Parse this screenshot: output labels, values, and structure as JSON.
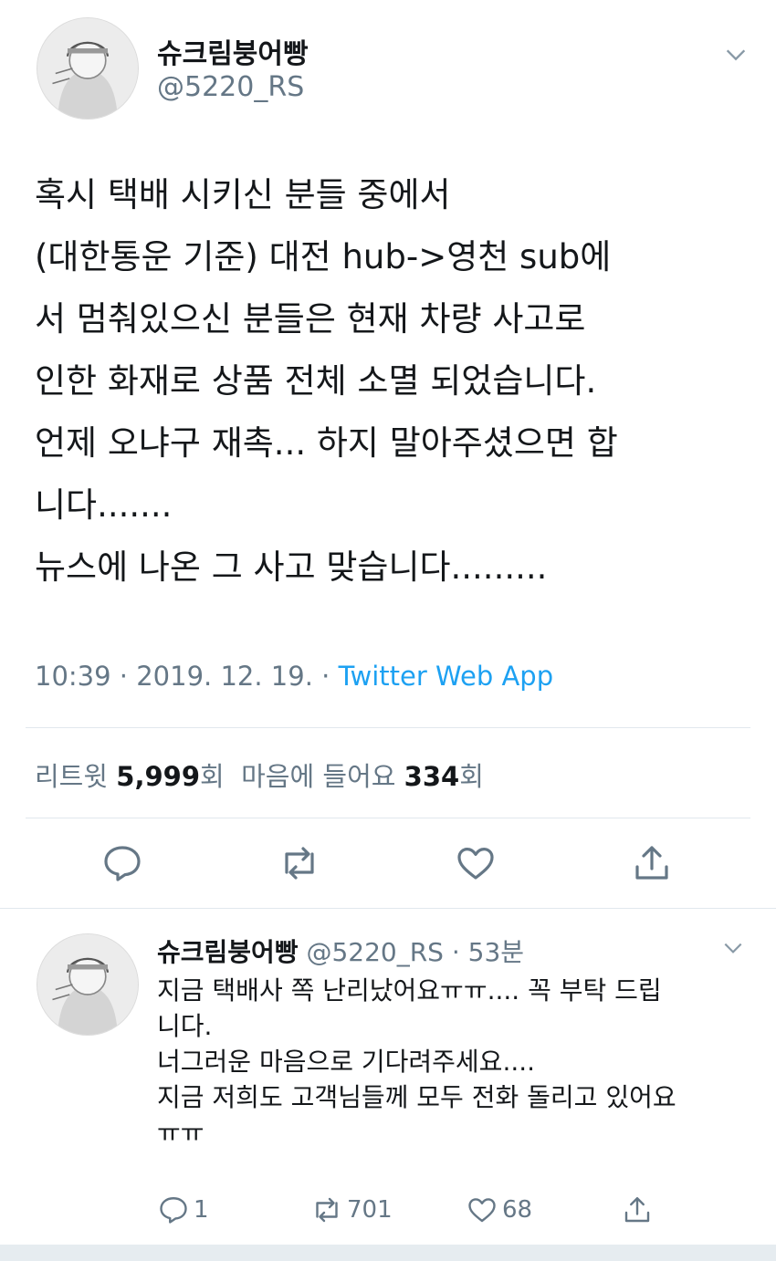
{
  "tweet": {
    "display_name": "슈크림붕어빵",
    "handle": "@5220_RS",
    "text": "혹시 택배 시키신 분들 중에서\n(대한통운 기준) 대전 hub->영천 sub에\n서 멈춰있으신 분들은 현재 차량 사고로\n인한 화재로 상품 전체 소멸 되었습니다.\n언제 오냐구 재촉... 하지 말아주셨으면 합\n니다.......\n뉴스에 나온 그 사고 맞습니다.........",
    "time": "10:39 · 2019. 12. 19. · ",
    "app": "Twitter Web App",
    "retweet_label": "리트윗 ",
    "retweet_count": "5,999",
    "retweet_unit": "회",
    "like_label": "마음에 들어요 ",
    "like_count": "334",
    "like_unit": "회"
  },
  "reply": {
    "display_name": "슈크림붕어빵",
    "handle_time": "@5220_RS · 53분",
    "text": "지금 택배사 쪽 난리났어요ㅠㅠ.... 꼭 부탁 드립\n니다.\n너그러운 마음으로 기다려주세요....\n지금 저희도 고객님들께 모두 전화 돌리고 있어요\nㅠㅠ",
    "reply_count": "1",
    "retweet_count": "701",
    "like_count": "68"
  },
  "icons": {
    "chevron": "chevron-down-icon",
    "reply": "reply-icon",
    "retweet": "retweet-icon",
    "like": "heart-icon",
    "share": "share-icon"
  },
  "colors": {
    "link": "#1da1f2",
    "secondary": "#657786",
    "divider": "#e1e8ed"
  }
}
